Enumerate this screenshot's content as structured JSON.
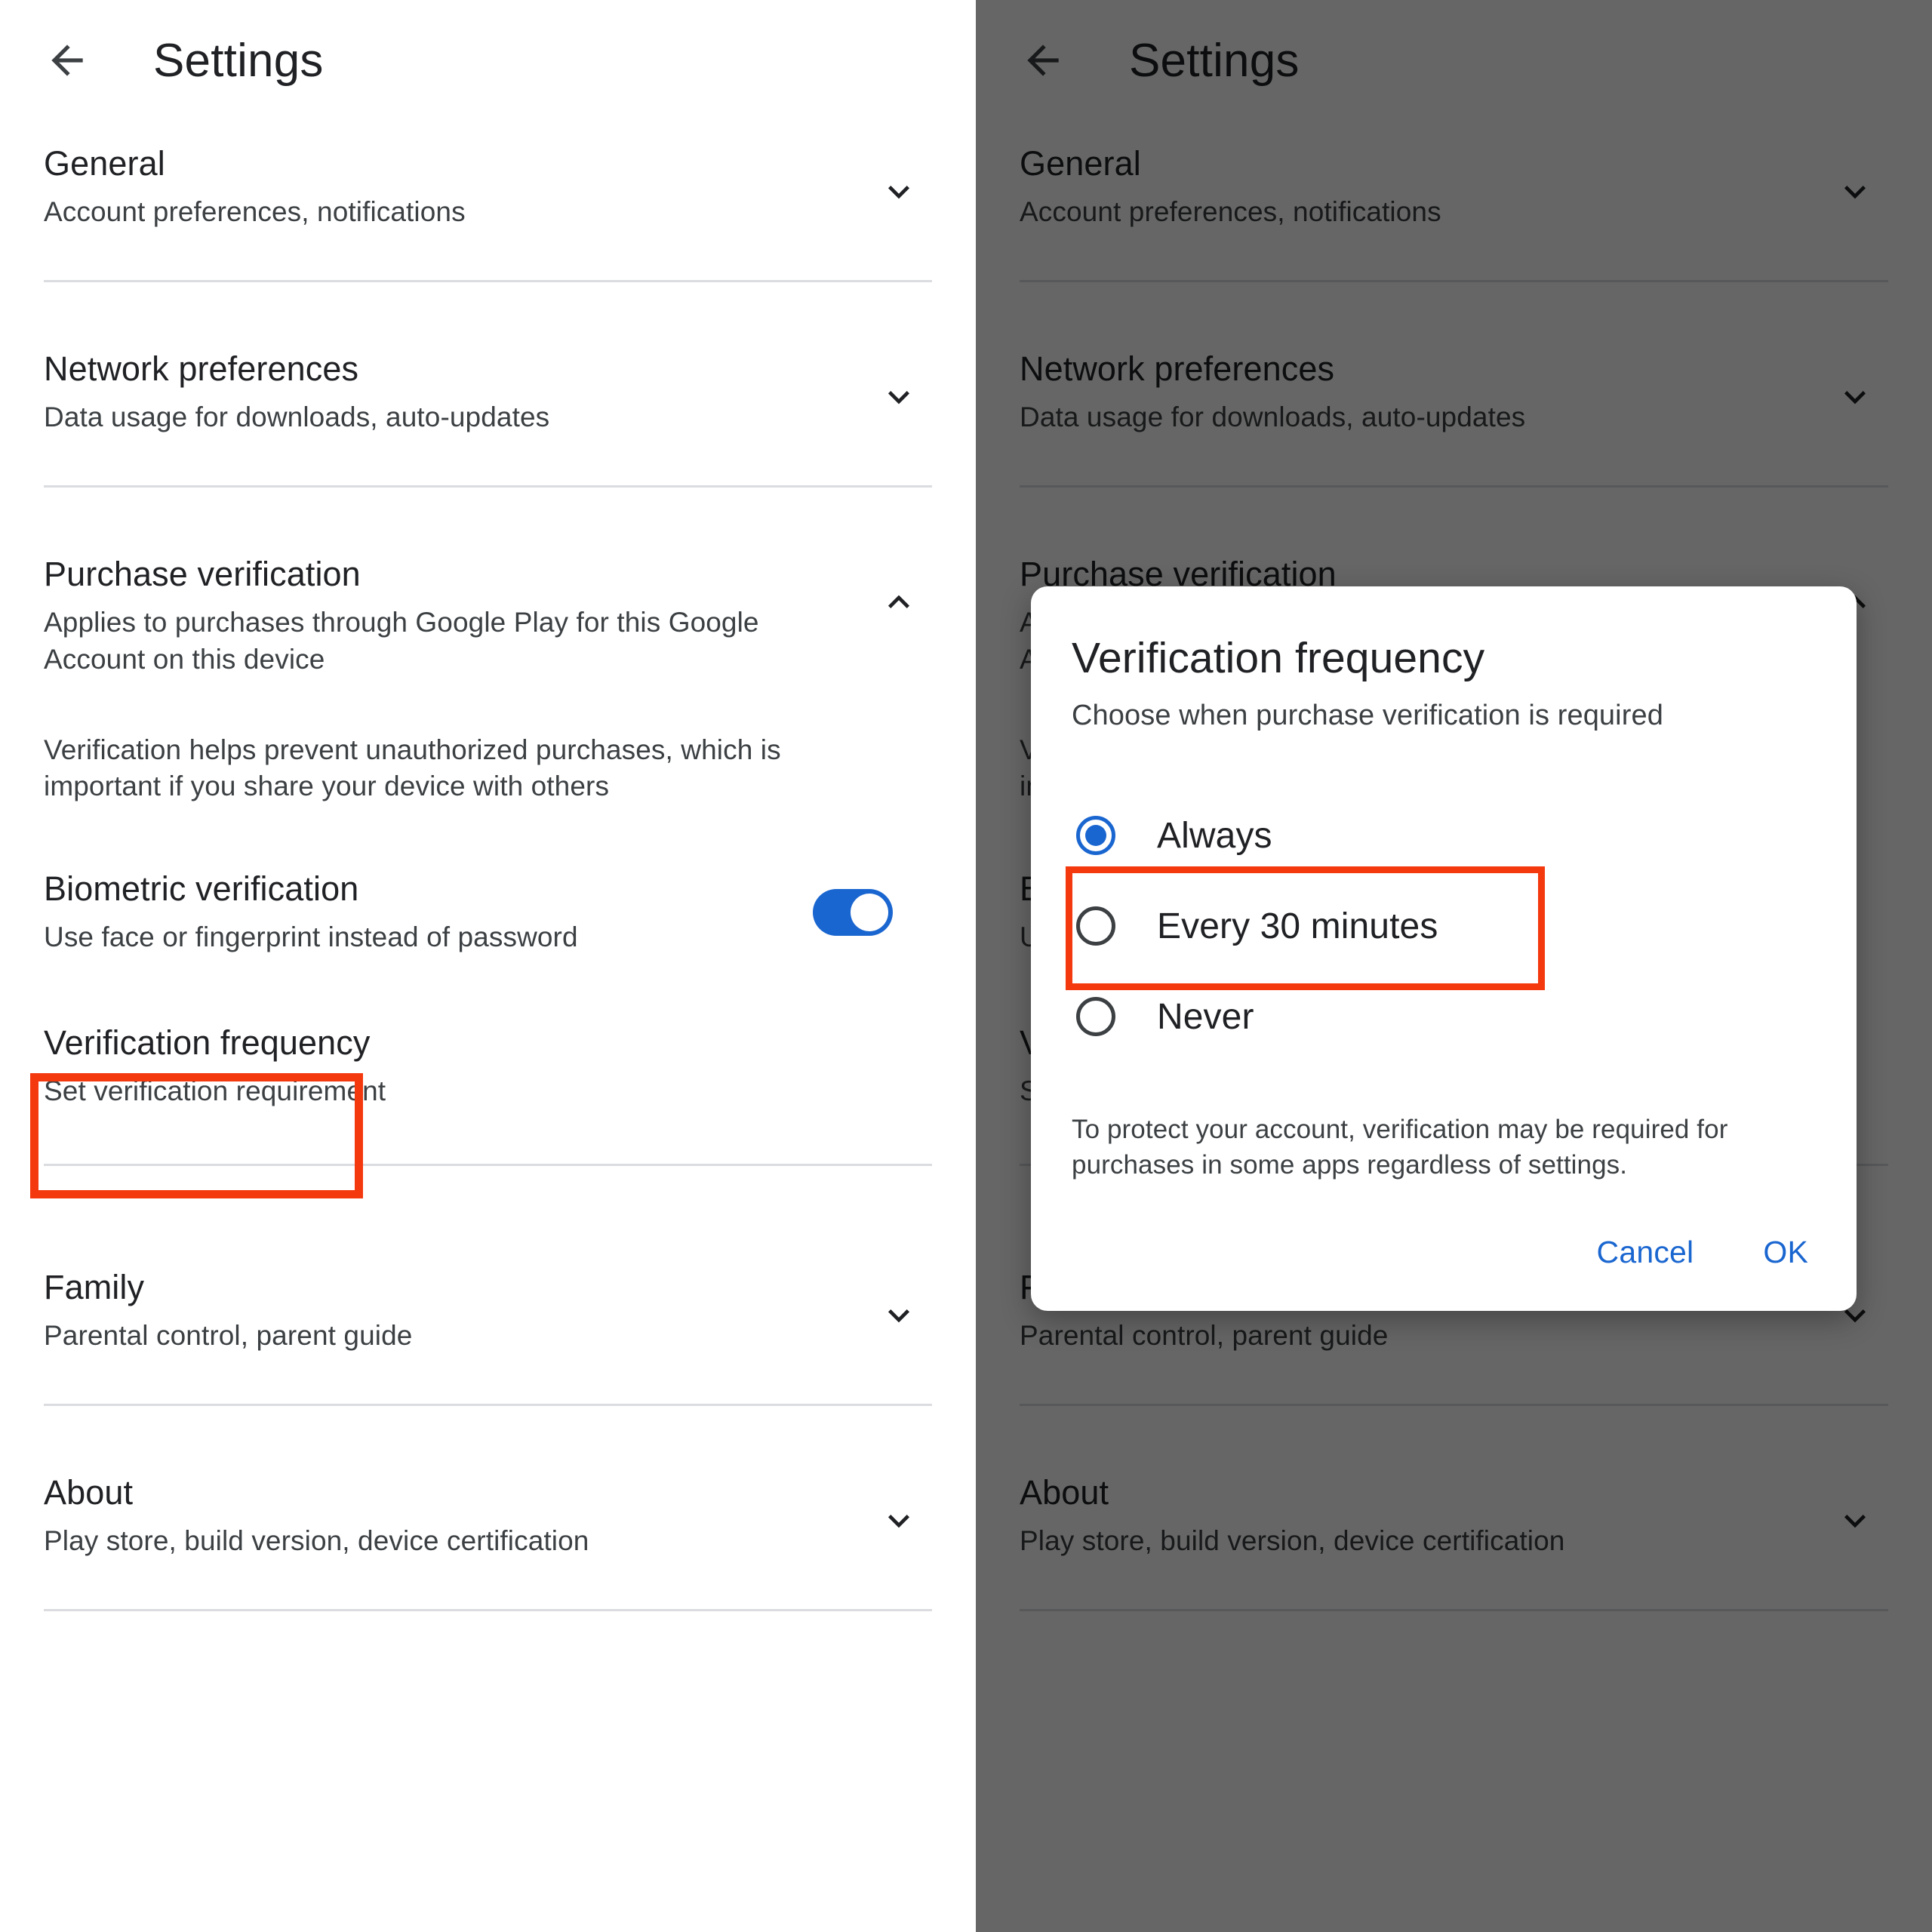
{
  "app": {
    "title": "Settings",
    "back_icon": "arrow-left-icon",
    "chevron_down_icon": "chevron-down-icon",
    "chevron_up_icon": "chevron-up-icon"
  },
  "colors": {
    "accent_blue": "#1a66d0",
    "highlight_red": "#f4390e",
    "scrim": "#666666",
    "text_primary": "#202124",
    "text_secondary": "#3c4043",
    "divider": "#dadce0"
  },
  "settings": {
    "general": {
      "title": "General",
      "subtitle": "Account preferences, notifications",
      "expanded": false
    },
    "network": {
      "title": "Network preferences",
      "subtitle": "Data usage for downloads, auto-updates",
      "expanded": false
    },
    "purchase_verification": {
      "title": "Purchase verification",
      "subtitle": "Applies to purchases through Google Play for this Google Account on this device",
      "expanded": true,
      "note": "Verification helps prevent unauthorized purchases, which is important if you share your device with others",
      "biometric": {
        "title": "Biometric verification",
        "subtitle": "Use face or fingerprint instead of password",
        "toggle_on": true
      },
      "verification_frequency": {
        "title": "Verification frequency",
        "subtitle": "Set verification requirement",
        "highlighted": true
      }
    },
    "family": {
      "title": "Family",
      "subtitle": "Parental control, parent guide",
      "expanded": false
    },
    "about": {
      "title": "About",
      "subtitle": "Play store, build version, device certification",
      "expanded": false
    }
  },
  "dialog": {
    "title": "Verification frequency",
    "subtitle": "Choose when purchase verification is required",
    "options": [
      {
        "label": "Always",
        "selected": true,
        "highlighted": false
      },
      {
        "label": "Every 30 minutes",
        "selected": false,
        "highlighted": true
      },
      {
        "label": "Never",
        "selected": false,
        "highlighted": false
      }
    ],
    "note": "To protect your account, verification may be required for purchases in some apps regardless of settings.",
    "cancel_label": "Cancel",
    "ok_label": "OK"
  }
}
